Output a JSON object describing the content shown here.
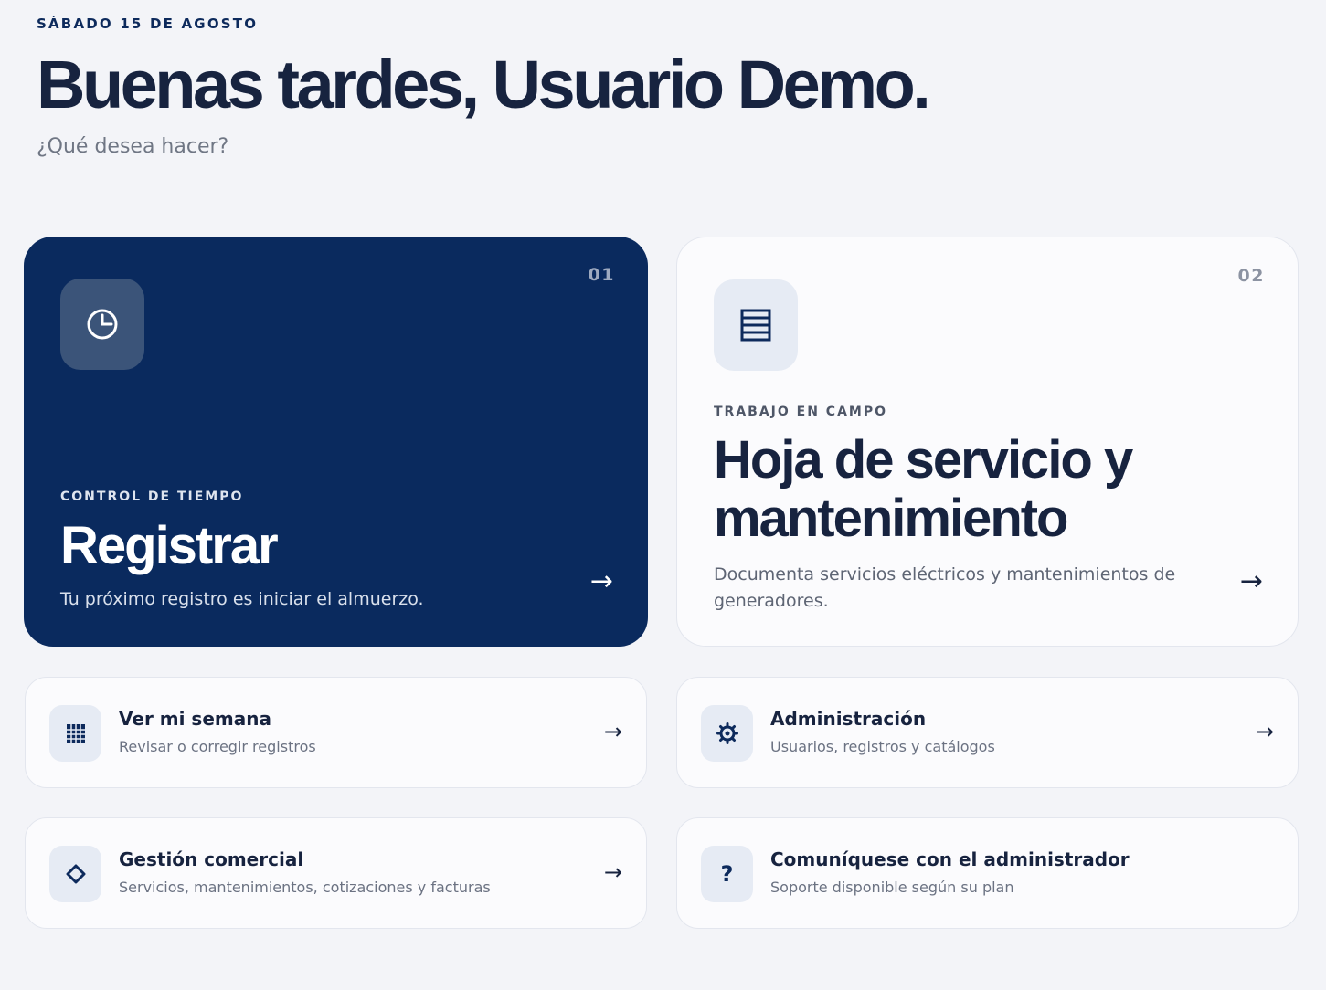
{
  "header": {
    "date": "SÁBADO 15 DE AGOSTO",
    "greeting": "Buenas tardes, Usuario Demo.",
    "question": "¿Qué desea hacer?"
  },
  "primary_cards": [
    {
      "number": "01",
      "icon": "clock-icon",
      "eyebrow": "CONTROL DE TIEMPO",
      "title": "Registrar",
      "description": "Tu próximo registro es iniciar el almuerzo.",
      "arrow": "→"
    },
    {
      "number": "02",
      "icon": "document-icon",
      "eyebrow": "TRABAJO EN CAMPO",
      "title": "Hoja de servicio y mantenimiento",
      "description": "Documenta servicios eléctricos y mantenimientos de generadores.",
      "arrow": "→"
    }
  ],
  "secondary_cards": [
    {
      "icon": "calendar-grid-icon",
      "title": "Ver mi semana",
      "subtitle": "Revisar o corregir registros",
      "arrow": "→"
    },
    {
      "icon": "gear-icon",
      "title": "Administración",
      "subtitle": "Usuarios, registros y catálogos",
      "arrow": "→"
    },
    {
      "icon": "diamond-icon",
      "title": "Gestión comercial",
      "subtitle": "Servicios, mantenimientos, cotizaciones y facturas",
      "arrow": "→"
    },
    {
      "icon": "question-icon",
      "icon_glyph": "?",
      "title": "Comuníquese con el administrador",
      "subtitle": "Soporte disponible según su plan"
    }
  ],
  "colors": {
    "background": "#f3f4f8",
    "primary": "#0a2a5e",
    "text": "#17233f",
    "muted": "#6b7282"
  }
}
